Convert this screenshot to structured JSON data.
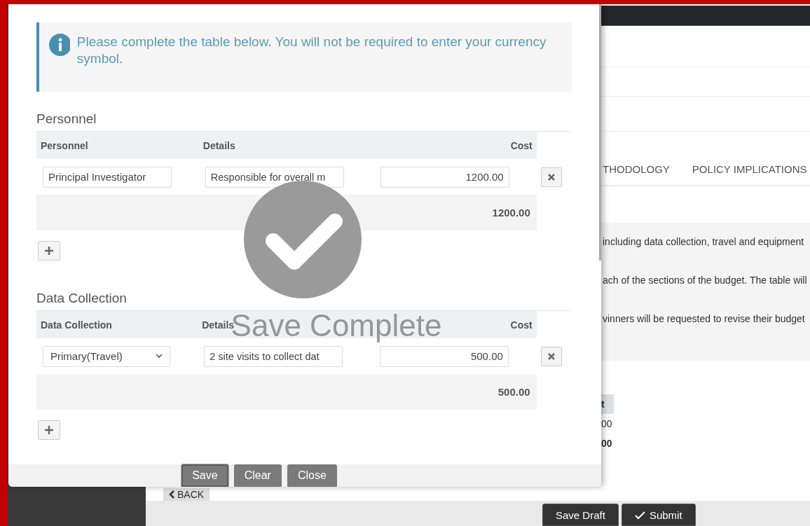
{
  "background": {
    "tabs": [
      {
        "label": "THODOLOGY",
        "selected": false
      },
      {
        "label": "POLICY IMPLICATIONS",
        "selected": false
      }
    ],
    "notes": [
      "including data collection, travel and equipment",
      "ach of the sections of the budget. The table will",
      "vinners will be requested to revise their budget"
    ],
    "table": {
      "column": "t",
      "cells": [
        {
          "text": "00",
          "bold": false
        },
        {
          "text": "00",
          "bold": true
        }
      ]
    },
    "back_button": "BACK",
    "actions": [
      {
        "label": "Save Draft"
      },
      {
        "label": "Submit"
      }
    ]
  },
  "modal": {
    "notice": "Please complete the table below. You will not be required to enter your currency symbol.",
    "sections": [
      {
        "title": "Personnel",
        "columns": [
          "Personnel",
          "Details",
          "Cost"
        ],
        "rows": [
          {
            "kind": "text",
            "item": "Principal Investigator",
            "details": "Responsible for overall m",
            "cost": "1200.00"
          }
        ],
        "total": "1200.00"
      },
      {
        "title": "Data Collection",
        "columns": [
          "Data Collection",
          "Details",
          "Cost"
        ],
        "rows": [
          {
            "kind": "select",
            "item": "Primary(Travel)",
            "details": "2 site visits to collect dat",
            "cost": "500.00"
          }
        ],
        "total": "500.00"
      }
    ],
    "toast": {
      "message": "Save Complete"
    },
    "buttons": [
      {
        "label": "Save",
        "focused": true
      },
      {
        "label": "Clear",
        "focused": false
      },
      {
        "label": "Close",
        "focused": false
      }
    ]
  }
}
